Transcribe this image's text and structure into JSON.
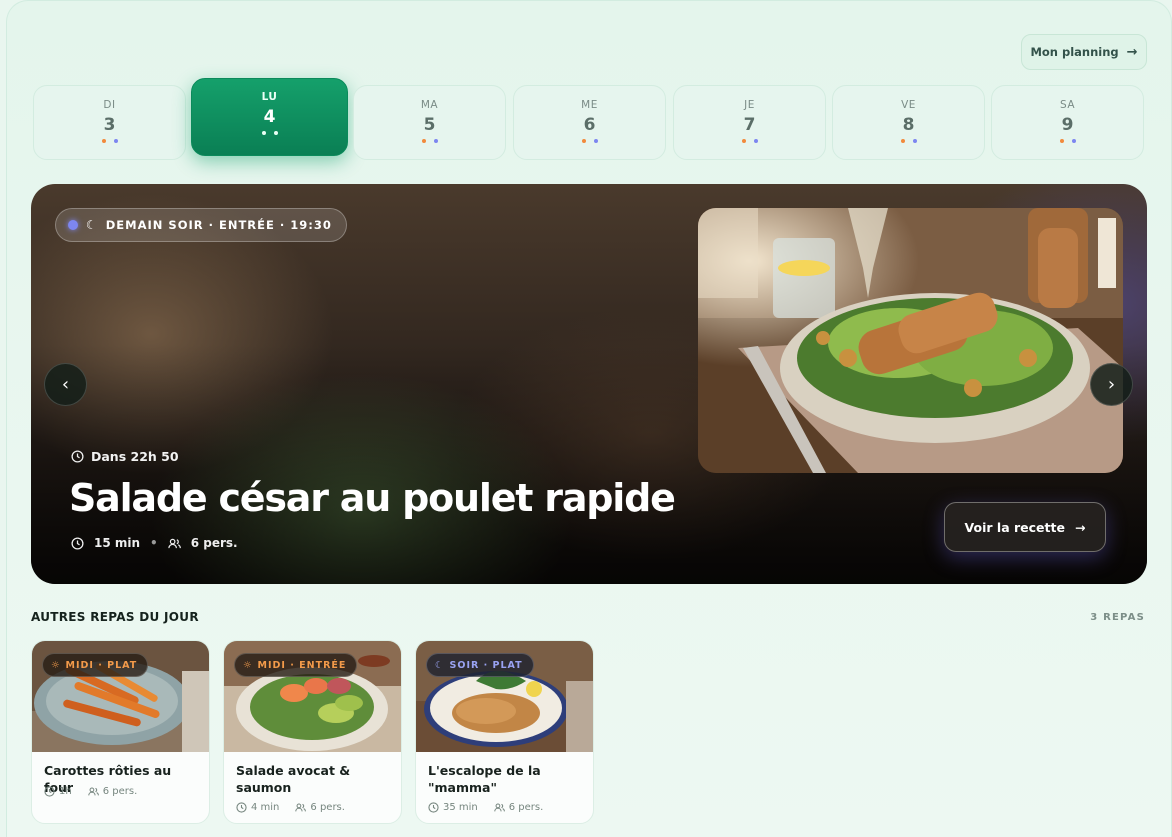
{
  "header": {
    "planning_label": "Mon planning"
  },
  "days": [
    {
      "name": "DI",
      "num": "3"
    },
    {
      "name": "LU",
      "num": "4"
    },
    {
      "name": "MA",
      "num": "5"
    },
    {
      "name": "ME",
      "num": "6"
    },
    {
      "name": "JE",
      "num": "7"
    },
    {
      "name": "VE",
      "num": "8"
    },
    {
      "name": "SA",
      "num": "9"
    }
  ],
  "hero": {
    "badge": "DEMAIN SOIR · ENTRÉE · 19:30",
    "countdown": "Dans 22h 50",
    "title": "Salade césar au poulet rapide",
    "time": "15 min",
    "persons": "6 pers.",
    "recipe_button": "Voir la recette"
  },
  "others": {
    "title": "AUTRES REPAS DU JOUR",
    "count": "3 REPAS",
    "cards": [
      {
        "tag": "MIDI · PLAT",
        "name": "Carottes rôties au four",
        "time": "1h",
        "persons": "6 pers."
      },
      {
        "tag": "MIDI · ENTRÉE",
        "name": "Salade avocat & saumon",
        "time": "4 min",
        "persons": "6 pers."
      },
      {
        "tag": "SOIR · PLAT",
        "name": "L'escalope de la \"mamma\"",
        "time": "35 min",
        "persons": "6 pers."
      }
    ]
  },
  "colors": {
    "accent": "#0f9463",
    "orange_dot": "#f28a3c",
    "violet_dot": "#7d86f0"
  }
}
